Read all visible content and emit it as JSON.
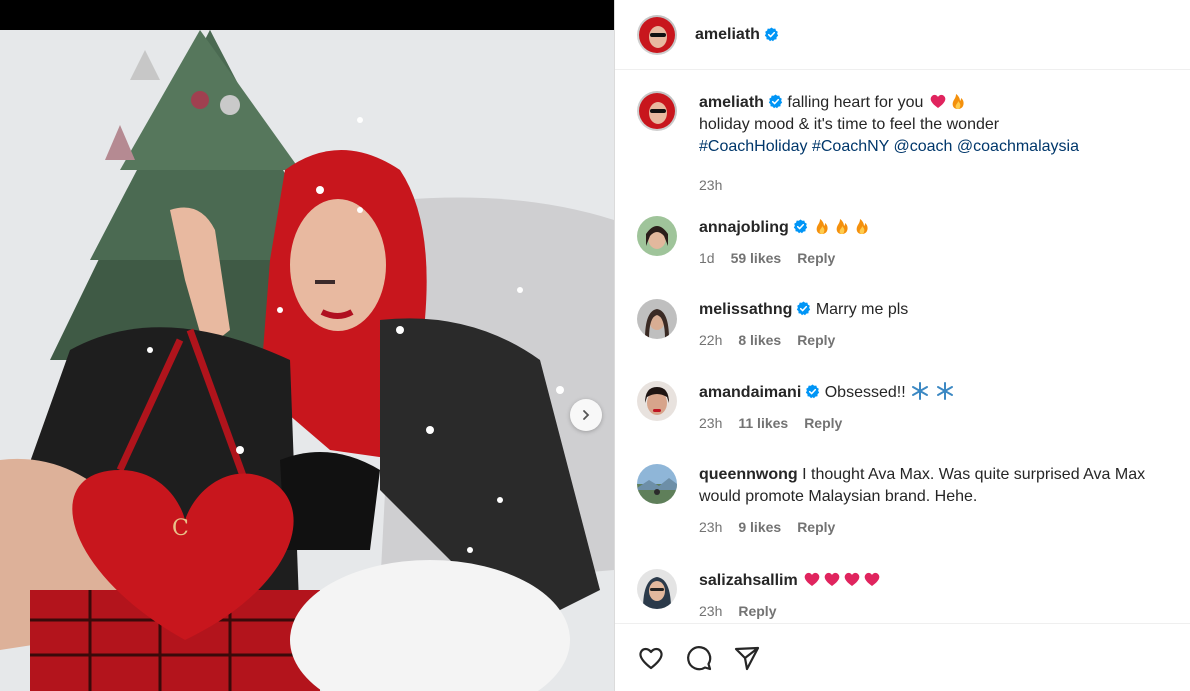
{
  "post": {
    "author": "ameliath",
    "caption_line1": "falling heart for you",
    "caption_line2": "holiday mood & it's time to feel the wonder",
    "tags": [
      "#CoachHoliday",
      "#CoachNY",
      "@coach",
      "@coachmalaysia"
    ],
    "time": "23h"
  },
  "comments": [
    {
      "user": "annajobling",
      "verified": true,
      "text": "",
      "time": "1d",
      "likes": "59 likes",
      "reply": "Reply"
    },
    {
      "user": "melissathng",
      "verified": true,
      "text": "Marry me pls",
      "time": "22h",
      "likes": "8 likes",
      "reply": "Reply"
    },
    {
      "user": "amandaimani",
      "verified": true,
      "text": "Obsessed!!",
      "time": "23h",
      "likes": "11 likes",
      "reply": "Reply"
    },
    {
      "user": "queennwong",
      "verified": false,
      "text": "I thought Ava Max. Was quite surprised Ava Max would promote Malaysian brand. Hehe.",
      "time": "23h",
      "likes": "9 likes",
      "reply": "Reply"
    },
    {
      "user": "salizahsallim",
      "verified": false,
      "text": "",
      "time": "23h",
      "likes": "",
      "reply": "Reply"
    }
  ],
  "icons": [
    "heart-icon",
    "comment-icon",
    "share-icon",
    "verified-icon",
    "next-arrow-icon"
  ],
  "colors": {
    "verified": "#0095f6",
    "link": "#00376b",
    "meta": "#737373",
    "heart_red": "#e0245e"
  }
}
